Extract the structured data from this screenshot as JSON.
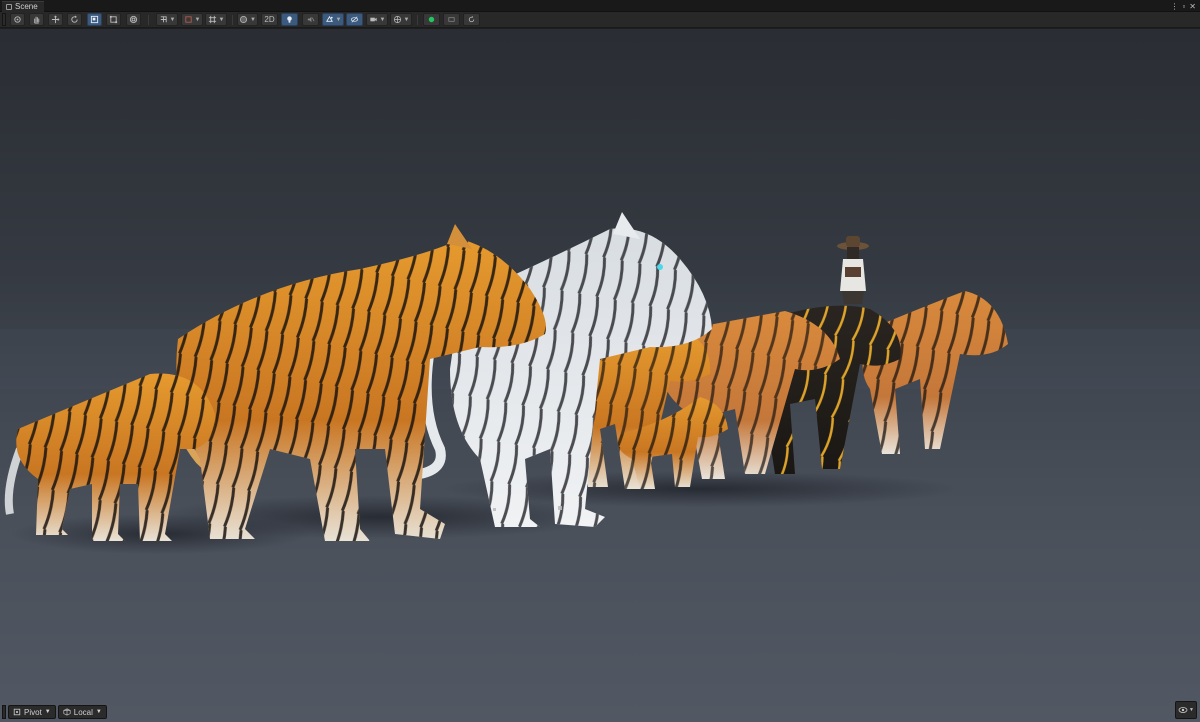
{
  "window": {
    "tab_title": "Scene",
    "icons": [
      "more-options-icon",
      "maximize-icon",
      "close-icon"
    ]
  },
  "toolbar": {
    "tools": [
      "view-tool-icon",
      "hand-tool-icon",
      "move-tool-icon",
      "rotate-tool-icon",
      "scale-tool-icon",
      "rect-tool-icon",
      "transform-tool-icon"
    ],
    "active_tool": "scale-tool-icon",
    "toggle_2d_label": "2D",
    "playback": [
      "play-icon",
      "pause-icon",
      "refresh-icon"
    ],
    "accent_color": "#3b5a7e",
    "play_color": "#22c55e"
  },
  "footer": {
    "pivot_label": "Pivot",
    "local_label": "Local"
  },
  "scene": {
    "sky_color": "#2a2d33",
    "ground_color": "#4a505a",
    "subjects": [
      "orange-tiger-cub",
      "large-orange-tiger",
      "white-tiger",
      "orange-tiger-medium",
      "tiger-cub-small",
      "orange-tiger-standing",
      "black-gold-glowing-tiger",
      "rider-figure",
      "orange-tiger-far"
    ]
  }
}
